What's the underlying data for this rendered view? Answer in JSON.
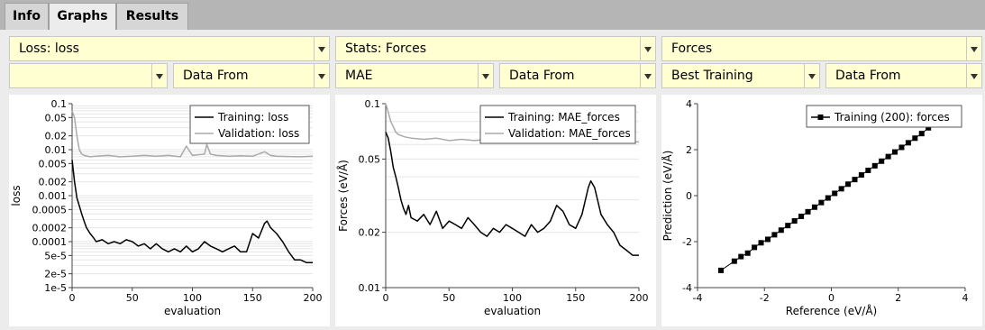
{
  "tabs": [
    {
      "label": "Info",
      "active": false
    },
    {
      "label": "Graphs",
      "active": true
    },
    {
      "label": "Results",
      "active": false
    }
  ],
  "panels": [
    {
      "dropdown_main": "Loss: loss",
      "dropdown_left": "",
      "dropdown_right": "Data From"
    },
    {
      "dropdown_main": "Stats: Forces",
      "dropdown_left": "MAE",
      "dropdown_right": "Data From"
    },
    {
      "dropdown_main": "Forces",
      "dropdown_left": "Best Training",
      "dropdown_right": "Data From"
    }
  ],
  "chart_data": [
    {
      "type": "line",
      "xlabel": "evaluation",
      "ylabel": "loss",
      "y_scale": "log",
      "xlim": [
        0,
        200
      ],
      "ylim": [
        1e-05,
        0.1
      ],
      "xticks": [
        "0",
        "50",
        "100",
        "150",
        "200"
      ],
      "yticks": [
        "1e-5",
        "2e-5",
        "5e-5",
        "0.0001",
        "0.0002",
        "0.0005",
        "0.001",
        "0.002",
        "0.005",
        "0.01",
        "0.02",
        "0.05",
        "0.1"
      ],
      "legend_position": "top-right",
      "series": [
        {
          "name": "Training: loss",
          "color": "#000000",
          "x": [
            0,
            2,
            4,
            6,
            8,
            10,
            12,
            15,
            18,
            20,
            25,
            30,
            35,
            40,
            45,
            50,
            55,
            60,
            65,
            70,
            75,
            80,
            85,
            90,
            95,
            100,
            105,
            110,
            115,
            120,
            125,
            130,
            135,
            140,
            145,
            150,
            155,
            160,
            162,
            165,
            170,
            175,
            180,
            185,
            190,
            195,
            200
          ],
          "y": [
            0.006,
            0.002,
            0.0009,
            0.0006,
            0.0004,
            0.00028,
            0.0002,
            0.00015,
            0.00012,
            0.0001,
            0.00011,
            9e-05,
            0.0001,
            9e-05,
            0.00011,
            0.0001,
            8e-05,
            9e-05,
            7e-05,
            9e-05,
            7e-05,
            6e-05,
            7e-05,
            6e-05,
            8e-05,
            6e-05,
            7e-05,
            0.0001,
            8e-05,
            7e-05,
            6e-05,
            7e-05,
            8e-05,
            6e-05,
            6e-05,
            0.00015,
            0.00012,
            0.00025,
            0.00028,
            0.0002,
            0.00015,
            0.0001,
            6e-05,
            4e-05,
            4e-05,
            3.5e-05,
            3.5e-05
          ]
        },
        {
          "name": "Validation: loss",
          "color": "#aaaaaa",
          "x": [
            0,
            2,
            4,
            6,
            8,
            10,
            15,
            20,
            30,
            40,
            50,
            60,
            70,
            80,
            90,
            95,
            100,
            110,
            112,
            115,
            120,
            130,
            140,
            150,
            160,
            165,
            170,
            180,
            190,
            200
          ],
          "y": [
            0.07,
            0.05,
            0.02,
            0.01,
            0.008,
            0.0075,
            0.007,
            0.0072,
            0.0075,
            0.007,
            0.0072,
            0.0075,
            0.0072,
            0.0075,
            0.007,
            0.012,
            0.0075,
            0.008,
            0.013,
            0.008,
            0.0075,
            0.0072,
            0.0074,
            0.0072,
            0.009,
            0.0075,
            0.0072,
            0.0071,
            0.007,
            0.0072
          ]
        }
      ]
    },
    {
      "type": "line",
      "xlabel": "evaluation",
      "ylabel": "Forces (eV/Å)",
      "y_scale": "log",
      "xlim": [
        0,
        200
      ],
      "ylim": [
        0.01,
        0.1
      ],
      "xticks": [
        "0",
        "50",
        "100",
        "150",
        "200"
      ],
      "yticks": [
        "0.01",
        "0.02",
        "0.05",
        "0.1"
      ],
      "legend_position": "top-right",
      "series": [
        {
          "name": "Training: MAE_forces",
          "color": "#000000",
          "x": [
            0,
            2,
            4,
            6,
            8,
            10,
            12,
            14,
            16,
            18,
            20,
            25,
            30,
            35,
            40,
            45,
            50,
            55,
            60,
            65,
            70,
            75,
            80,
            85,
            90,
            95,
            100,
            105,
            110,
            115,
            120,
            125,
            130,
            135,
            140,
            145,
            150,
            155,
            160,
            162,
            165,
            170,
            175,
            180,
            185,
            190,
            195,
            200
          ],
          "y": [
            0.07,
            0.065,
            0.055,
            0.045,
            0.04,
            0.035,
            0.03,
            0.027,
            0.025,
            0.028,
            0.024,
            0.023,
            0.025,
            0.022,
            0.026,
            0.021,
            0.023,
            0.022,
            0.021,
            0.024,
            0.022,
            0.02,
            0.019,
            0.021,
            0.02,
            0.022,
            0.021,
            0.02,
            0.019,
            0.022,
            0.02,
            0.021,
            0.023,
            0.028,
            0.026,
            0.022,
            0.021,
            0.025,
            0.035,
            0.038,
            0.035,
            0.025,
            0.022,
            0.02,
            0.017,
            0.016,
            0.015,
            0.015
          ]
        },
        {
          "name": "Validation: MAE_forces",
          "color": "#aaaaaa",
          "x": [
            0,
            2,
            4,
            6,
            8,
            10,
            15,
            20,
            30,
            40,
            50,
            60,
            70,
            80,
            90,
            100,
            110,
            120,
            130,
            140,
            150,
            160,
            170,
            180,
            190,
            200
          ],
          "y": [
            0.1,
            0.09,
            0.08,
            0.075,
            0.07,
            0.068,
            0.066,
            0.065,
            0.064,
            0.065,
            0.063,
            0.064,
            0.063,
            0.064,
            0.063,
            0.064,
            0.063,
            0.063,
            0.064,
            0.063,
            0.063,
            0.066,
            0.063,
            0.063,
            0.062,
            0.062
          ]
        }
      ]
    },
    {
      "type": "scatter",
      "xlabel": "Reference (eV/Å)",
      "ylabel": "Prediction (eV/Å)",
      "xlim": [
        -4,
        4
      ],
      "ylim": [
        -4,
        4
      ],
      "xticks": [
        "-4",
        "-2",
        "0",
        "2",
        "4"
      ],
      "yticks": [
        "-4",
        "-2",
        "0",
        "2",
        "4"
      ],
      "legend_position": "top-right",
      "series": [
        {
          "name": "Training (200): forces",
          "color": "#000000",
          "x": [
            -3.3,
            -2.9,
            -2.7,
            -2.5,
            -2.3,
            -2.1,
            -1.9,
            -1.7,
            -1.5,
            -1.3,
            -1.1,
            -0.9,
            -0.7,
            -0.5,
            -0.3,
            -0.1,
            0.1,
            0.3,
            0.5,
            0.7,
            0.9,
            1.1,
            1.3,
            1.5,
            1.7,
            1.9,
            2.1,
            2.3,
            2.5,
            2.7,
            2.9
          ],
          "y": [
            -3.25,
            -2.85,
            -2.65,
            -2.5,
            -2.25,
            -2.05,
            -1.9,
            -1.7,
            -1.5,
            -1.3,
            -1.1,
            -0.9,
            -0.7,
            -0.5,
            -0.3,
            -0.1,
            0.1,
            0.3,
            0.5,
            0.7,
            0.9,
            1.1,
            1.3,
            1.5,
            1.7,
            1.9,
            2.1,
            2.3,
            2.5,
            2.7,
            2.95
          ]
        }
      ]
    }
  ]
}
